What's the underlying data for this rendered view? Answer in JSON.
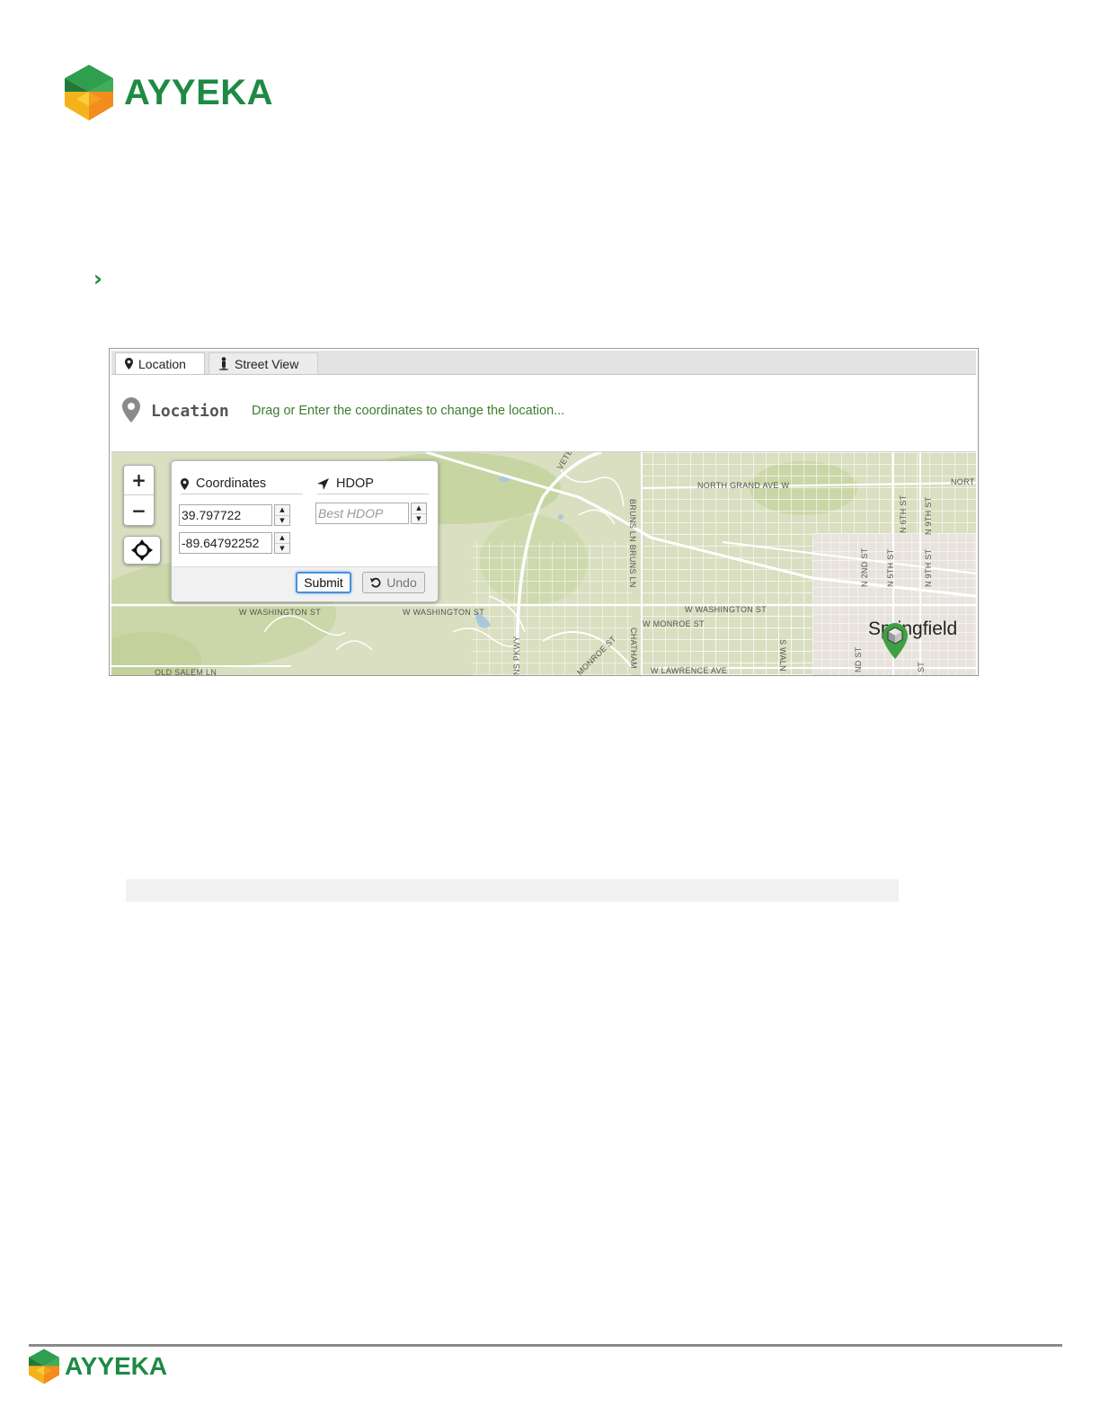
{
  "brand": {
    "name": "AYYEKA",
    "color": "#1e8a44"
  },
  "bullet": {
    "icon": "chevron-right-icon",
    "glyph": "›"
  },
  "tabs": [
    {
      "label": "Location",
      "icon": "map-pin-icon",
      "active": true
    },
    {
      "label": "Street View",
      "icon": "pegman-icon",
      "active": false
    }
  ],
  "location": {
    "title": "Location",
    "hint": "Drag or Enter the coordinates to change the location..."
  },
  "panel": {
    "coordinates_label": "Coordinates",
    "hdop_label": "HDOP",
    "latitude": "39.797722",
    "longitude": "-89.64792252",
    "hdop_placeholder": "Best HDOP",
    "submit_label": "Submit",
    "undo_label": "Undo"
  },
  "map": {
    "zoom_in": "+",
    "zoom_out": "−",
    "city": "Springfield",
    "streets": {
      "veterans": "VETERANS P",
      "north_grand": "NORTH GRAND AVE W",
      "nort": "NORT",
      "brunsln": "BRUNS LN BRUNS LN",
      "n6th": "N 6TH ST",
      "n9th_a": "N 9TH ST",
      "n2nd": "N 2ND ST",
      "n5th": "N 5TH ST",
      "n9th_b": "N 9TH ST",
      "w_wash_1": "W WASHINGTON ST",
      "w_wash_2": "W WASHINGTON ST",
      "w_wash_3": "W WASHINGTON ST",
      "w_monroe": "W MONROE ST",
      "chatham": "CHATHAM",
      "w_lawrence": "W LAWRENCE AVE",
      "s_waln": "S WALN",
      "nd_st": "ND ST",
      "st": "ST",
      "ns_pkwy": "NS PKWY",
      "monroe_st": "MONROE ST",
      "old_salem": "OLD SALEM LN"
    }
  }
}
